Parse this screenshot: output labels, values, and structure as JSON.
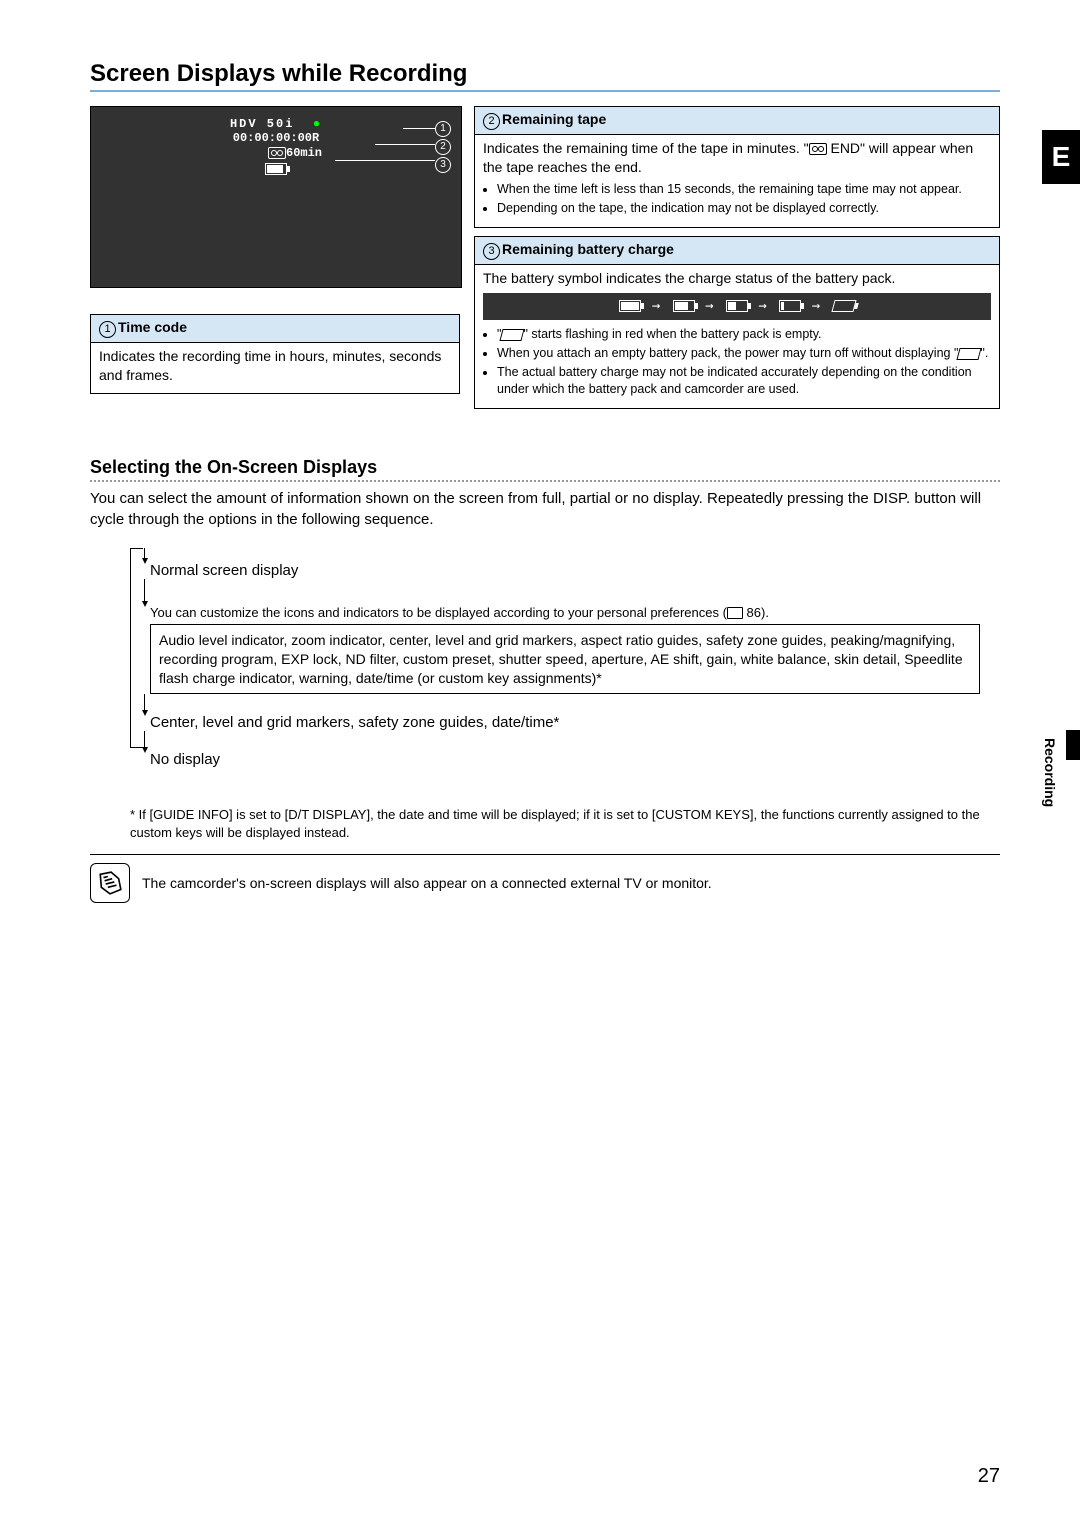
{
  "section_title": "Screen Displays while Recording",
  "tab_letter": "E",
  "side_label": "Recording",
  "screen": {
    "line1": "HDV 50i",
    "timecode": "00:00:00:00R",
    "line3_tape": "60min"
  },
  "box_timecode": {
    "header_num": "1",
    "header_text": "Time code",
    "body": "Indicates the recording time in hours, minutes, seconds and frames."
  },
  "box_tape": {
    "header_num": "2",
    "header_text": "Remaining tape",
    "body_main": "Indicates the remaining time of the tape in minutes. \" END\" will appear when the tape reaches the end.",
    "bullets": [
      "When the time left is less than 15 seconds, the remaining tape time may not appear.",
      "Depending on the tape, the indication may not be displayed correctly."
    ]
  },
  "box_battery": {
    "header_num": "3",
    "header_text": "Remaining battery charge",
    "body_main": "The battery symbol indicates the charge status of the battery pack.",
    "bullets": [
      "\" \" starts flashing in red when the battery pack is empty.",
      "When you attach an empty battery pack, the power may turn off without displaying \" \".",
      "The actual battery charge may not be indicated accurately depending on the condition under which the battery pack and camcorder are used."
    ]
  },
  "osd": {
    "subtitle": "Selecting the On-Screen Displays",
    "intro": "You can select the amount of information shown on the screen from full, partial or no display. Repeatedly pressing the DISP. button will cycle through the options in the following sequence.",
    "item1": "Normal screen display",
    "item1_sub_pre": "You can customize the icons and indicators to be displayed according to your personal preferences (",
    "item1_sub_page": " 86).",
    "item1_box": "Audio level indicator, zoom indicator, center, level and grid markers, aspect ratio guides, safety zone guides, peaking/magnifying, recording program, EXP lock, ND filter, custom preset, shutter speed, aperture, AE shift, gain, white balance, skin detail, Speedlite flash charge indicator, warning, date/time (or custom key assignments)*",
    "item2": "Center, level and grid markers, safety zone guides, date/time*",
    "item3": "No display",
    "footnote": "* If [GUIDE INFO] is set to [D/T DISPLAY], the date and time will be displayed; if it is set to [CUSTOM KEYS], the functions currently assigned to the custom keys will be displayed instead.",
    "note": "The camcorder's on-screen displays will also appear on a connected external TV or monitor."
  },
  "page_number": "27"
}
